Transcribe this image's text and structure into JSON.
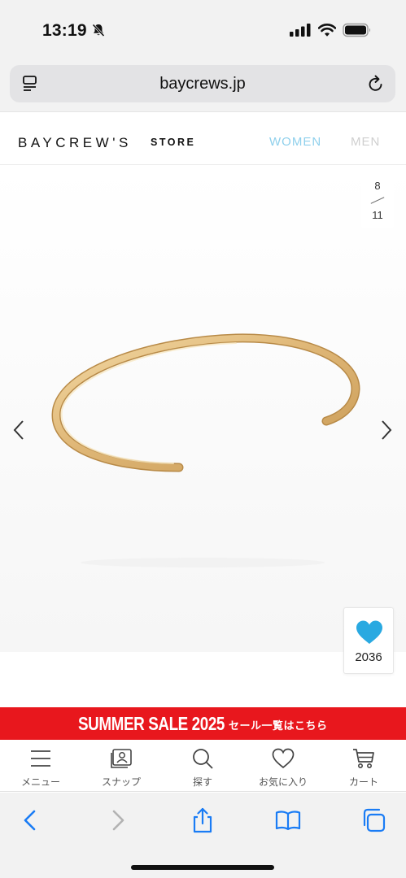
{
  "status_bar": {
    "time": "13:19",
    "icons": [
      "bell-slash-icon",
      "cellular-signal-icon",
      "wifi-icon",
      "battery-icon"
    ]
  },
  "browser": {
    "url": "baycrews.jp",
    "icons": [
      "reader-icon",
      "reload-icon"
    ]
  },
  "site_header": {
    "logo_main": "BAYCREW'S",
    "logo_sub": "STORE",
    "nav": [
      {
        "label": "WOMEN",
        "color": "#8fd0ec"
      },
      {
        "label": "MEN",
        "color": "#cfcfcf"
      }
    ]
  },
  "product_gallery": {
    "current": "8",
    "total": "11",
    "image": "gold-cuff-bangle",
    "favorite_count": "2036",
    "heart_color": "#29a9e1"
  },
  "sale_banner": {
    "title": "SUMMER SALE 2025",
    "link": "セール一覧はこちら",
    "background": "#e8171d"
  },
  "bottom_nav": [
    {
      "label": "メニュー",
      "icon": "menu-icon"
    },
    {
      "label": "スナップ",
      "icon": "snap-icon"
    },
    {
      "label": "探す",
      "icon": "search-icon"
    },
    {
      "label": "お気に入り",
      "icon": "heart-icon"
    },
    {
      "label": "カート",
      "icon": "cart-icon"
    }
  ],
  "safari_toolbar": {
    "icons": [
      "back-icon",
      "forward-icon",
      "share-icon",
      "bookmarks-icon",
      "tabs-icon"
    ],
    "accent": "#1a7cf5"
  }
}
